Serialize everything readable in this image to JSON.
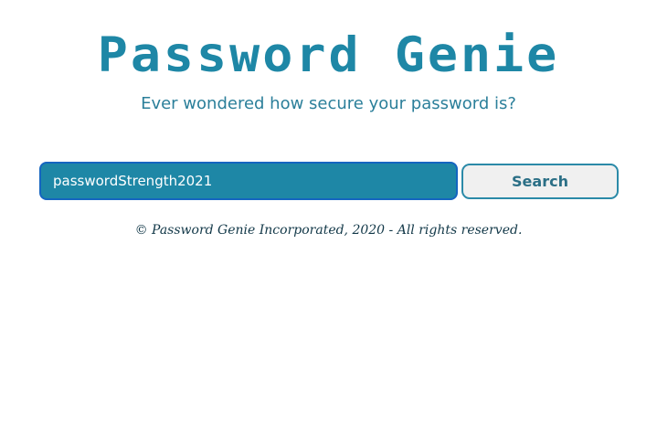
{
  "header": {
    "title": "Password Genie",
    "subtitle": "Ever wondered how secure your password is?"
  },
  "search": {
    "value": "passwordStrength2021",
    "button_label": "Search"
  },
  "footer": {
    "copyright": "© Password Genie Incorporated, 2020 - All rights reserved."
  },
  "colors": {
    "accent": "#1e87a6",
    "input_border": "#1565c0",
    "button_bg": "#f0f0f0",
    "footer_text": "#123848"
  }
}
